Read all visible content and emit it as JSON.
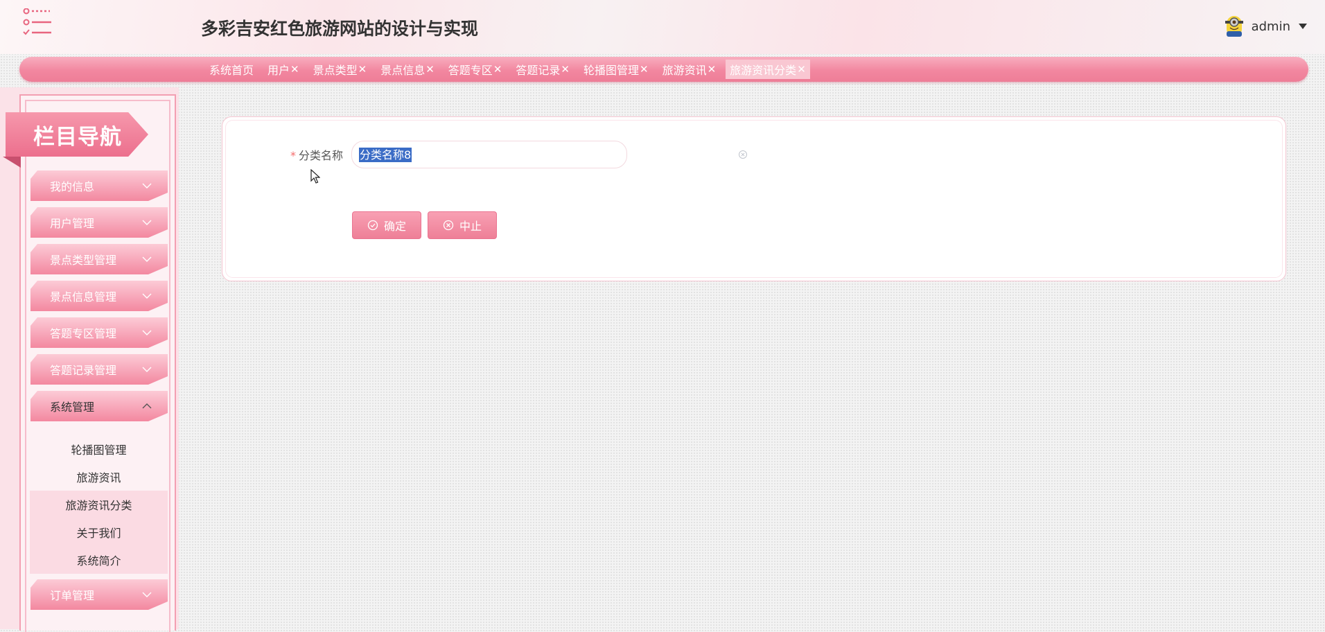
{
  "header": {
    "title": "多彩吉安红色旅游网站的设计与实现",
    "user": "admin"
  },
  "tabs": [
    {
      "label": "系统首页",
      "closable": false,
      "active": false
    },
    {
      "label": "用户",
      "closable": true,
      "active": false
    },
    {
      "label": "景点类型",
      "closable": true,
      "active": false
    },
    {
      "label": "景点信息",
      "closable": true,
      "active": false
    },
    {
      "label": "答题专区",
      "closable": true,
      "active": false
    },
    {
      "label": "答题记录",
      "closable": true,
      "active": false
    },
    {
      "label": "轮播图管理",
      "closable": true,
      "active": false
    },
    {
      "label": "旅游资讯",
      "closable": true,
      "active": false
    },
    {
      "label": "旅游资讯分类",
      "closable": true,
      "active": true
    }
  ],
  "tab_close_glyph": "✕",
  "sidebar": {
    "heading": "栏目导航",
    "items": [
      {
        "label": "我的信息",
        "open": false
      },
      {
        "label": "用户管理",
        "open": false
      },
      {
        "label": "景点类型管理",
        "open": false
      },
      {
        "label": "景点信息管理",
        "open": false
      },
      {
        "label": "答题专区管理",
        "open": false
      },
      {
        "label": "答题记录管理",
        "open": false
      },
      {
        "label": "系统管理",
        "open": true
      },
      {
        "label": "订单管理",
        "open": false
      }
    ],
    "submenu": [
      {
        "label": "轮播图管理",
        "highlight": false
      },
      {
        "label": "旅游资讯",
        "highlight": false
      },
      {
        "label": "旅游资讯分类",
        "highlight": true
      },
      {
        "label": "关于我们",
        "highlight": true
      },
      {
        "label": "系统简介",
        "highlight": true
      }
    ]
  },
  "form": {
    "field_label": "分类名称",
    "required_mark": "*",
    "field_value": "分类名称8",
    "confirm_label": "确定",
    "abort_label": "中止"
  },
  "colors": {
    "accent": "#ee7f97",
    "accent_light": "#f8a0b3",
    "selection": "#3b6cc6",
    "required": "#f56c6c"
  }
}
